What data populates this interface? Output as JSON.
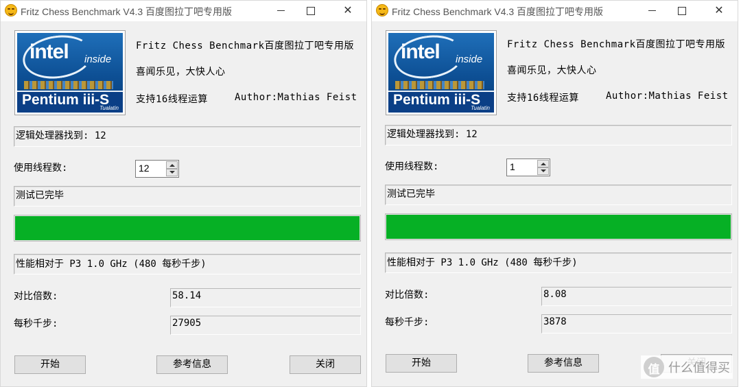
{
  "windows": [
    {
      "title": "Fritz Chess Benchmark V4.3   百度图拉丁吧专用版",
      "logo": {
        "brand": "intel",
        "inside": "inside",
        "product": "Pentium iii-S",
        "sub": "Tualatin"
      },
      "info_line1": "Fritz Chess Benchmark百度图拉丁吧专用版",
      "info_line2": "喜闻乐见，大快人心",
      "info_line3": "支持16线程运算",
      "author": "Author:Mathias Feist",
      "logical_processors": "逻辑处理器找到: 12",
      "threads_label": "使用线程数:",
      "threads_value": "12",
      "status": "测试已完毕",
      "progress": 1.0,
      "relative": "性能相对于 P3 1.0 GHz (480 每秒千步)",
      "ratio_label": "对比倍数:",
      "ratio_value": "58.14",
      "kns_label": "每秒千步:",
      "kns_value": "27905",
      "btn_start": "开始",
      "btn_info": "参考信息",
      "btn_close": "关闭"
    },
    {
      "title": "Fritz Chess Benchmark V4.3   百度图拉丁吧专用版",
      "logo": {
        "brand": "intel",
        "inside": "inside",
        "product": "Pentium iii-S",
        "sub": "Tualatin"
      },
      "info_line1": "Fritz Chess Benchmark百度图拉丁吧专用版",
      "info_line2": "喜闻乐见，大快人心",
      "info_line3": "支持16线程运算",
      "author": "Author:Mathias Feist",
      "logical_processors": "逻辑处理器找到: 12",
      "threads_label": "使用线程数:",
      "threads_value": "1",
      "status": "测试已完毕",
      "progress": 1.0,
      "relative": "性能相对于 P3 1.0 GHz (480 每秒千步)",
      "ratio_label": "对比倍数:",
      "ratio_value": "8.08",
      "kns_label": "每秒千步:",
      "kns_value": "3878",
      "btn_start": "开始",
      "btn_info": "参考信息",
      "btn_close": "关闭"
    }
  ],
  "colors": {
    "progress_green": "#06b025",
    "window_bg": "#f0f0f0"
  },
  "watermark": {
    "icon": "zhi-icon",
    "text": "什么值得买"
  }
}
